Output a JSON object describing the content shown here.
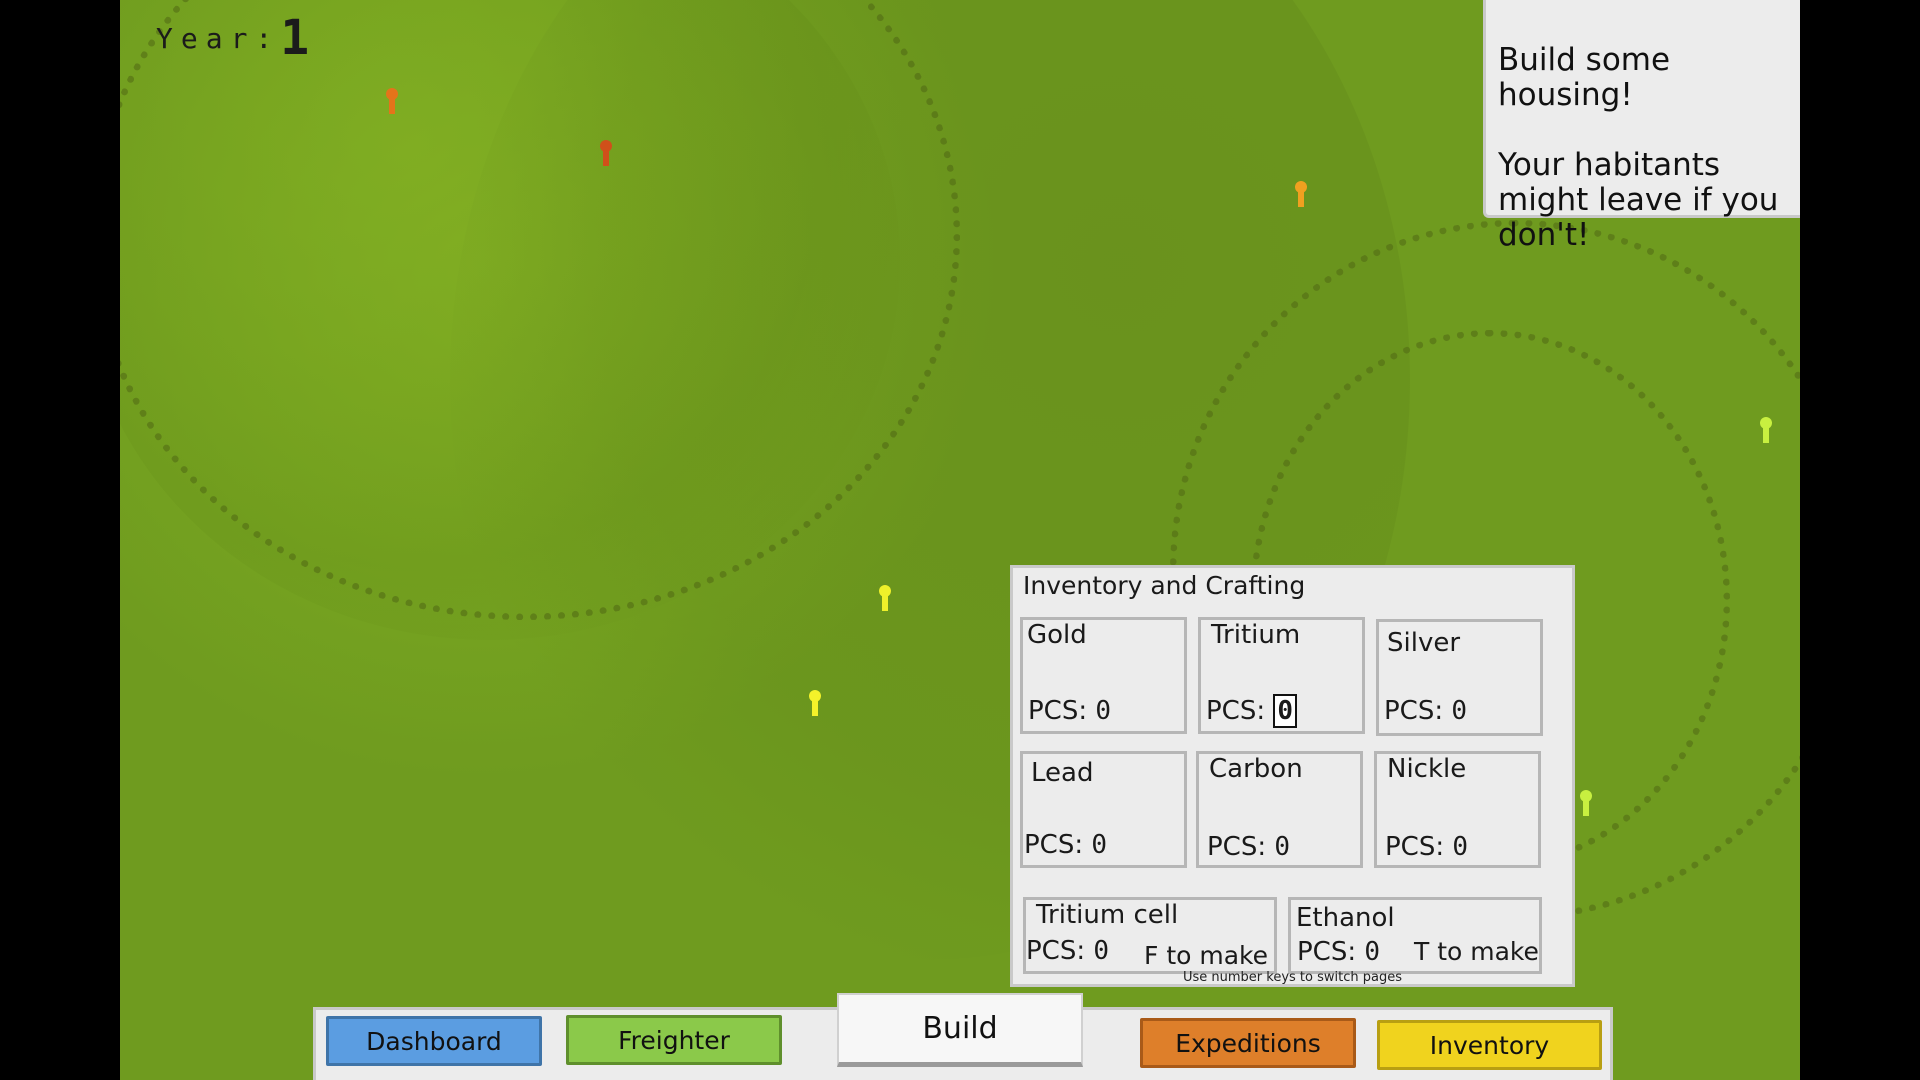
{
  "hud": {
    "year_label": "Year:",
    "year_value": "1"
  },
  "notice": {
    "text": "Build some housing!\n\nYour habitants might leave if you don't!"
  },
  "inventory": {
    "title": "Inventory and Crafting",
    "pcs_label": "PCS:",
    "resources": [
      {
        "name": "Gold",
        "count": "0"
      },
      {
        "name": "Tritium",
        "count": "0"
      },
      {
        "name": "Silver",
        "count": "0"
      },
      {
        "name": "Lead",
        "count": "0"
      },
      {
        "name": "Carbon",
        "count": "0"
      },
      {
        "name": "Nickle",
        "count": "0"
      }
    ],
    "crafts": [
      {
        "name": "Tritium cell",
        "count": "0",
        "make": "F to make"
      },
      {
        "name": "Ethanol",
        "count": "0",
        "make": "T to make"
      }
    ],
    "hint": "Use number keys to switch pages"
  },
  "taskbar": {
    "dashboard": "Dashboard",
    "freighter": "Freighter",
    "build": "Build",
    "expeditions": "Expeditions",
    "inventory": "Inventory"
  },
  "colors": {
    "ground": "#77a520",
    "dashboard": "#5b9de1",
    "freighter": "#8bc94a",
    "expeditions": "#de7f2a",
    "inventory": "#f0d31e",
    "pin_orange": "#e4741a",
    "pin_amber": "#f0a020",
    "pin_yellow": "#eef02a",
    "pin_lime": "#c8f040"
  }
}
